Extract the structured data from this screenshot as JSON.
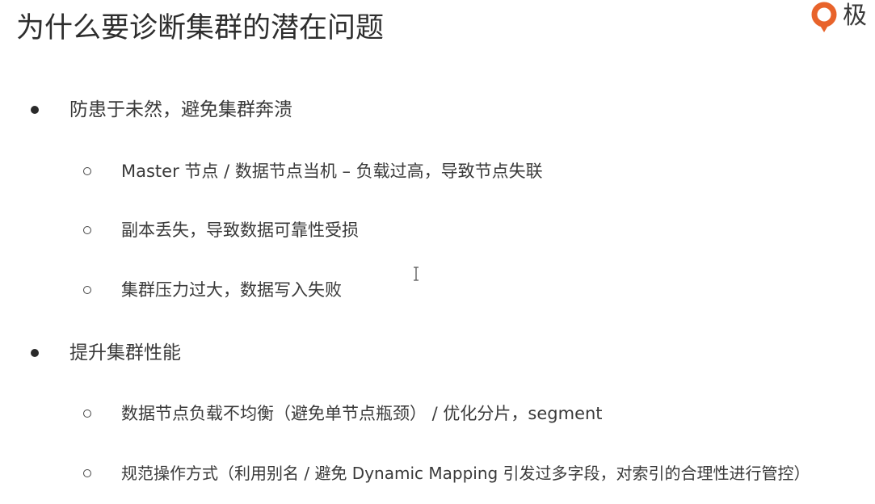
{
  "slide": {
    "title": "为什么要诊断集群的潜在问题",
    "logo_text": "极",
    "logo_icon": "geekbang-logo-icon",
    "accent_color": "#e8632b",
    "sections": [
      {
        "label": "防患于未然，避免集群奔溃",
        "items": [
          "Master 节点 / 数据节点当机 – 负载过高，导致节点失联",
          "副本丢失，导致数据可靠性受损",
          "集群压力过大，数据写入失败"
        ]
      },
      {
        "label": "提升集群性能",
        "items": [
          "数据节点负载不均衡（避免单节点瓶颈） / 优化分片，segment",
          "规范操作方式（利用别名 / 避免 Dynamic Mapping 引发过多字段，对索引的合理性进行管控）"
        ]
      }
    ]
  }
}
